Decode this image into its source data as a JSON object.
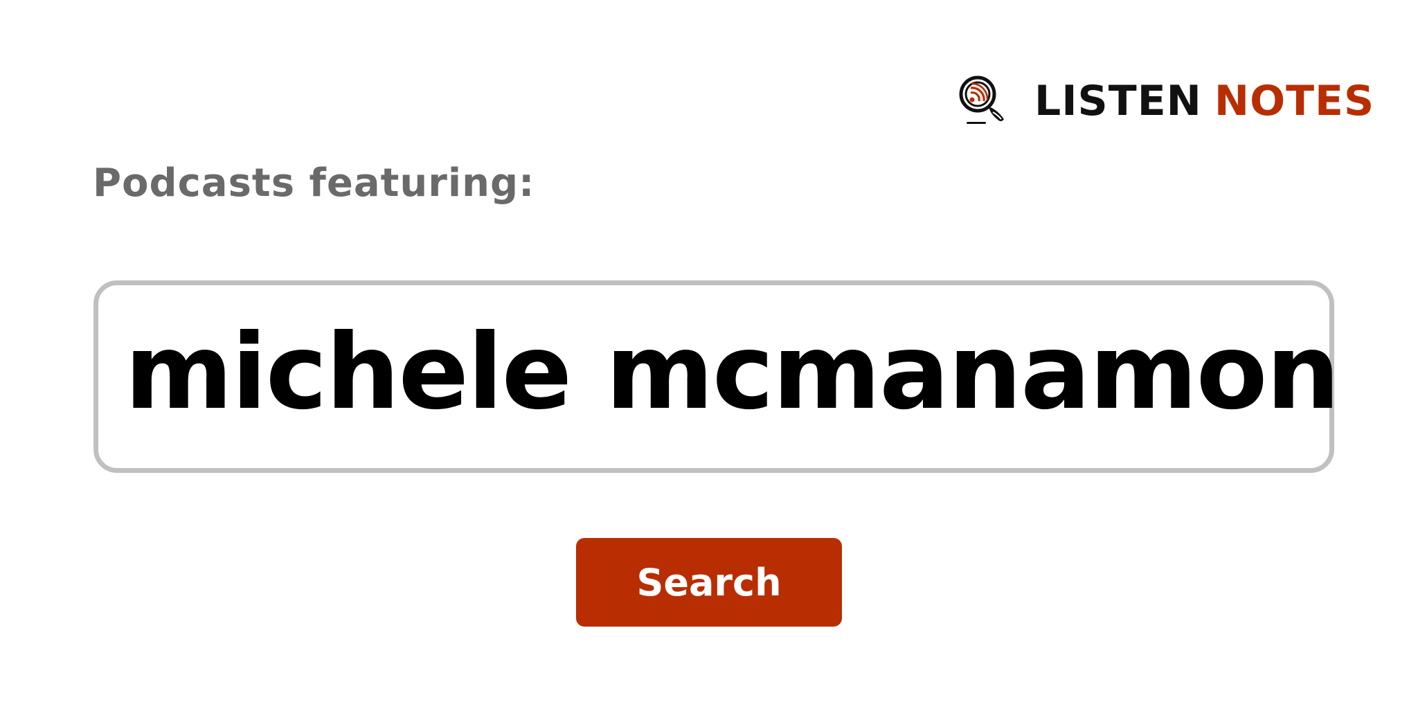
{
  "brand": {
    "word_1": "LISTEN",
    "word_2": "NOTES",
    "icon": "podcast-search-icon",
    "colors": {
      "dark": "#111111",
      "accent": "#b82e02"
    }
  },
  "heading": "Podcasts featuring:",
  "search": {
    "value": "michele mcmanamon"
  },
  "search_button": {
    "label": "Search",
    "color": "#b82e02"
  }
}
